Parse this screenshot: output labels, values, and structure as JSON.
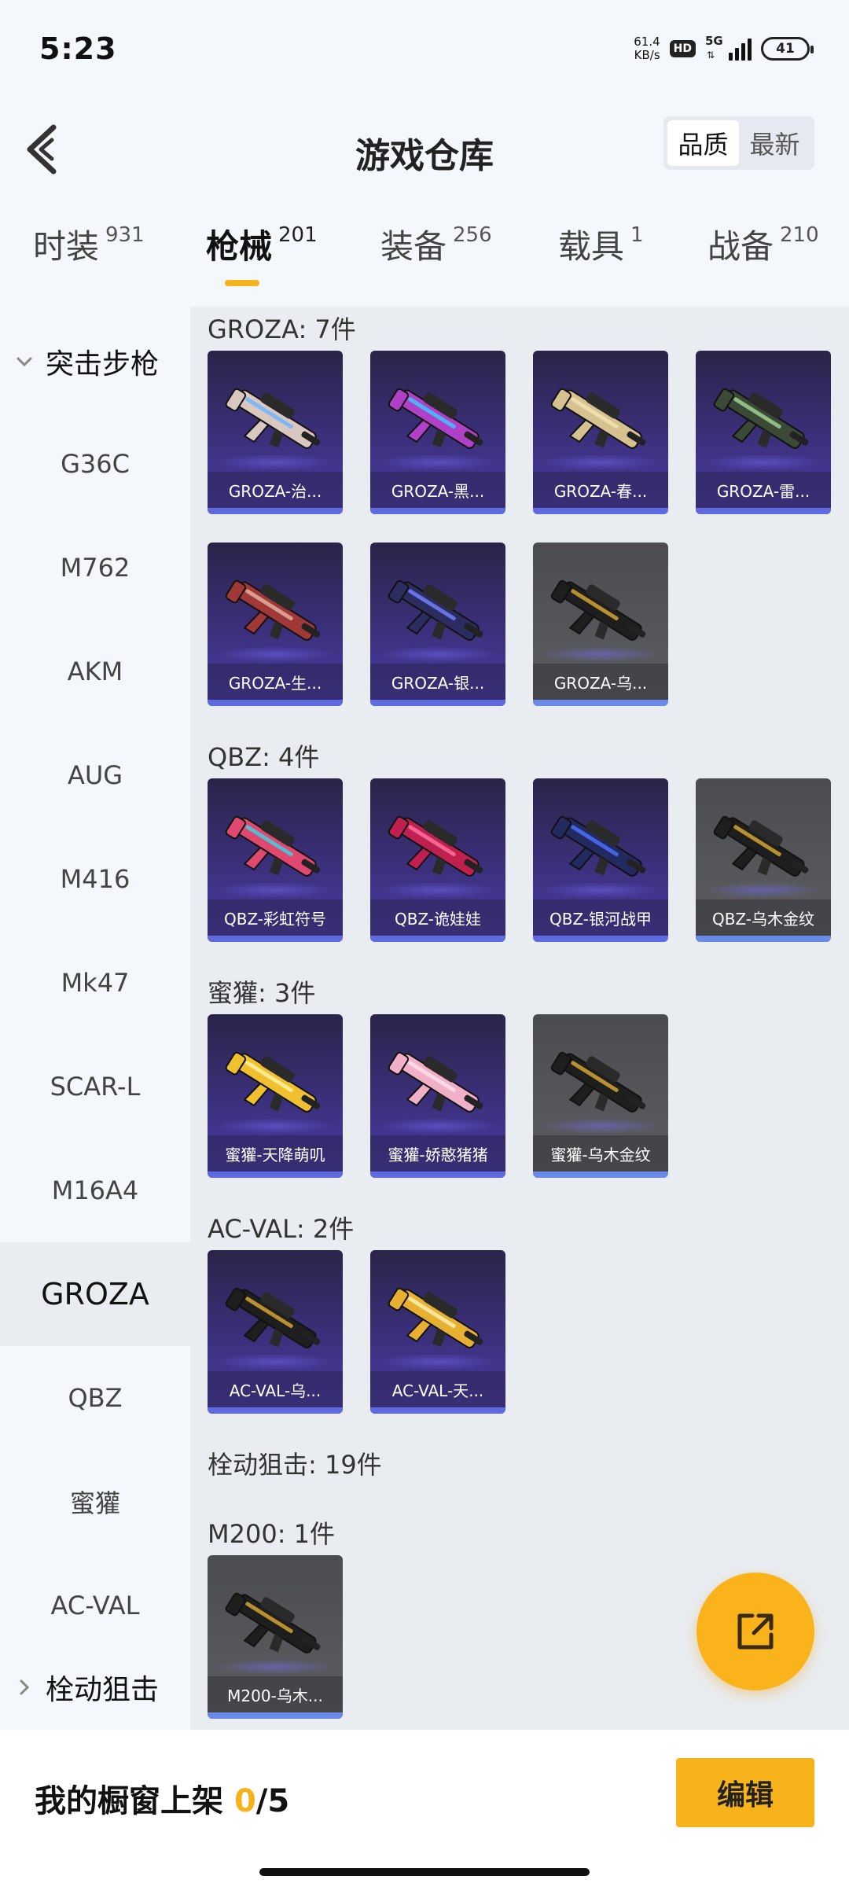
{
  "status_bar": {
    "time": "5:23",
    "net_speed_value": "61.4",
    "net_speed_unit": "KB/s",
    "hd": "HD",
    "network": "5G",
    "battery": "41"
  },
  "header": {
    "title": "游戏仓库",
    "sort_options": [
      "品质",
      "最新"
    ],
    "sort_active": "品质"
  },
  "tabs": [
    {
      "label": "时装",
      "count": "931"
    },
    {
      "label": "枪械",
      "count": "201",
      "active": true
    },
    {
      "label": "装备",
      "count": "256"
    },
    {
      "label": "载具",
      "count": "1"
    },
    {
      "label": "战备",
      "count": "210"
    }
  ],
  "sidebar": {
    "category_open": "突击步枪",
    "items": [
      "G36C",
      "M762",
      "AKM",
      "AUG",
      "M416",
      "Mk47",
      "SCAR-L",
      "M16A4",
      "GROZA",
      "QBZ",
      "蜜獾",
      "AC-VAL"
    ],
    "active_item": "GROZA",
    "category_closed": "栓动狙击"
  },
  "sections": [
    {
      "title": "GROZA: 7件",
      "items": [
        {
          "name": "GROZA-治...",
          "tier": "purple",
          "gun_color": "#d8c8c0",
          "accent": "#6fb5ff"
        },
        {
          "name": "GROZA-黑...",
          "tier": "purple",
          "gun_color": "#b040c8",
          "accent": "#3cc8ff"
        },
        {
          "name": "GROZA-春...",
          "tier": "purple",
          "gun_color": "#d6c290",
          "accent": "#f0e2b0"
        },
        {
          "name": "GROZA-雷...",
          "tier": "purple",
          "gun_color": "#3a4a36",
          "accent": "#9fd090"
        },
        {
          "name": "GROZA-生...",
          "tier": "purple",
          "gun_color": "#a03838",
          "accent": "#e0b0a0"
        },
        {
          "name": "GROZA-银...",
          "tier": "purple",
          "gun_color": "#2c2c60",
          "accent": "#7080ff"
        },
        {
          "name": "GROZA-乌...",
          "tier": "gray",
          "gun_color": "#1e1e1e",
          "accent": "#d4a530"
        }
      ]
    },
    {
      "title": "QBZ: 4件",
      "items": [
        {
          "name": "QBZ-彩虹符号",
          "tier": "purple",
          "gun_color": "#e04870",
          "accent": "#40d0e0"
        },
        {
          "name": "QBZ-诡娃娃",
          "tier": "purple",
          "gun_color": "#c02050",
          "accent": "#ff70a0"
        },
        {
          "name": "QBZ-银河战甲",
          "tier": "purple",
          "gun_color": "#222a60",
          "accent": "#4a70ff"
        },
        {
          "name": "QBZ-乌木金纹",
          "tier": "gray",
          "gun_color": "#1e1e1e",
          "accent": "#d4a530"
        }
      ]
    },
    {
      "title": "蜜獾: 3件",
      "items": [
        {
          "name": "蜜獾-天降萌叽",
          "tier": "purple",
          "gun_color": "#f0c030",
          "accent": "#fff0a0"
        },
        {
          "name": "蜜獾-娇憨猪猪",
          "tier": "purple",
          "gun_color": "#f2b0c8",
          "accent": "#ffe0ea"
        },
        {
          "name": "蜜獾-乌木金纹",
          "tier": "gray",
          "gun_color": "#1e1e1e",
          "accent": "#d4a530"
        }
      ]
    },
    {
      "title": "AC-VAL: 2件",
      "items": [
        {
          "name": "AC-VAL-乌...",
          "tier": "purple",
          "gun_color": "#1e1e1e",
          "accent": "#d4a530"
        },
        {
          "name": "AC-VAL-天...",
          "tier": "purple",
          "gun_color": "#e8b030",
          "accent": "#fff0b0"
        }
      ]
    },
    {
      "title": "栓动狙击: 19件",
      "items": []
    },
    {
      "title": "M200: 1件",
      "items": [
        {
          "name": "M200-乌木...",
          "tier": "gray",
          "gun_color": "#1e1e1e",
          "accent": "#d4a530"
        }
      ]
    }
  ],
  "showcase": {
    "label": "我的橱窗上架",
    "count": "0",
    "total": "/5"
  },
  "edit_button": "编辑",
  "colors": {
    "accent": "#f6b21b",
    "card_purple": "#3a2f78",
    "card_gray": "#55565a"
  }
}
